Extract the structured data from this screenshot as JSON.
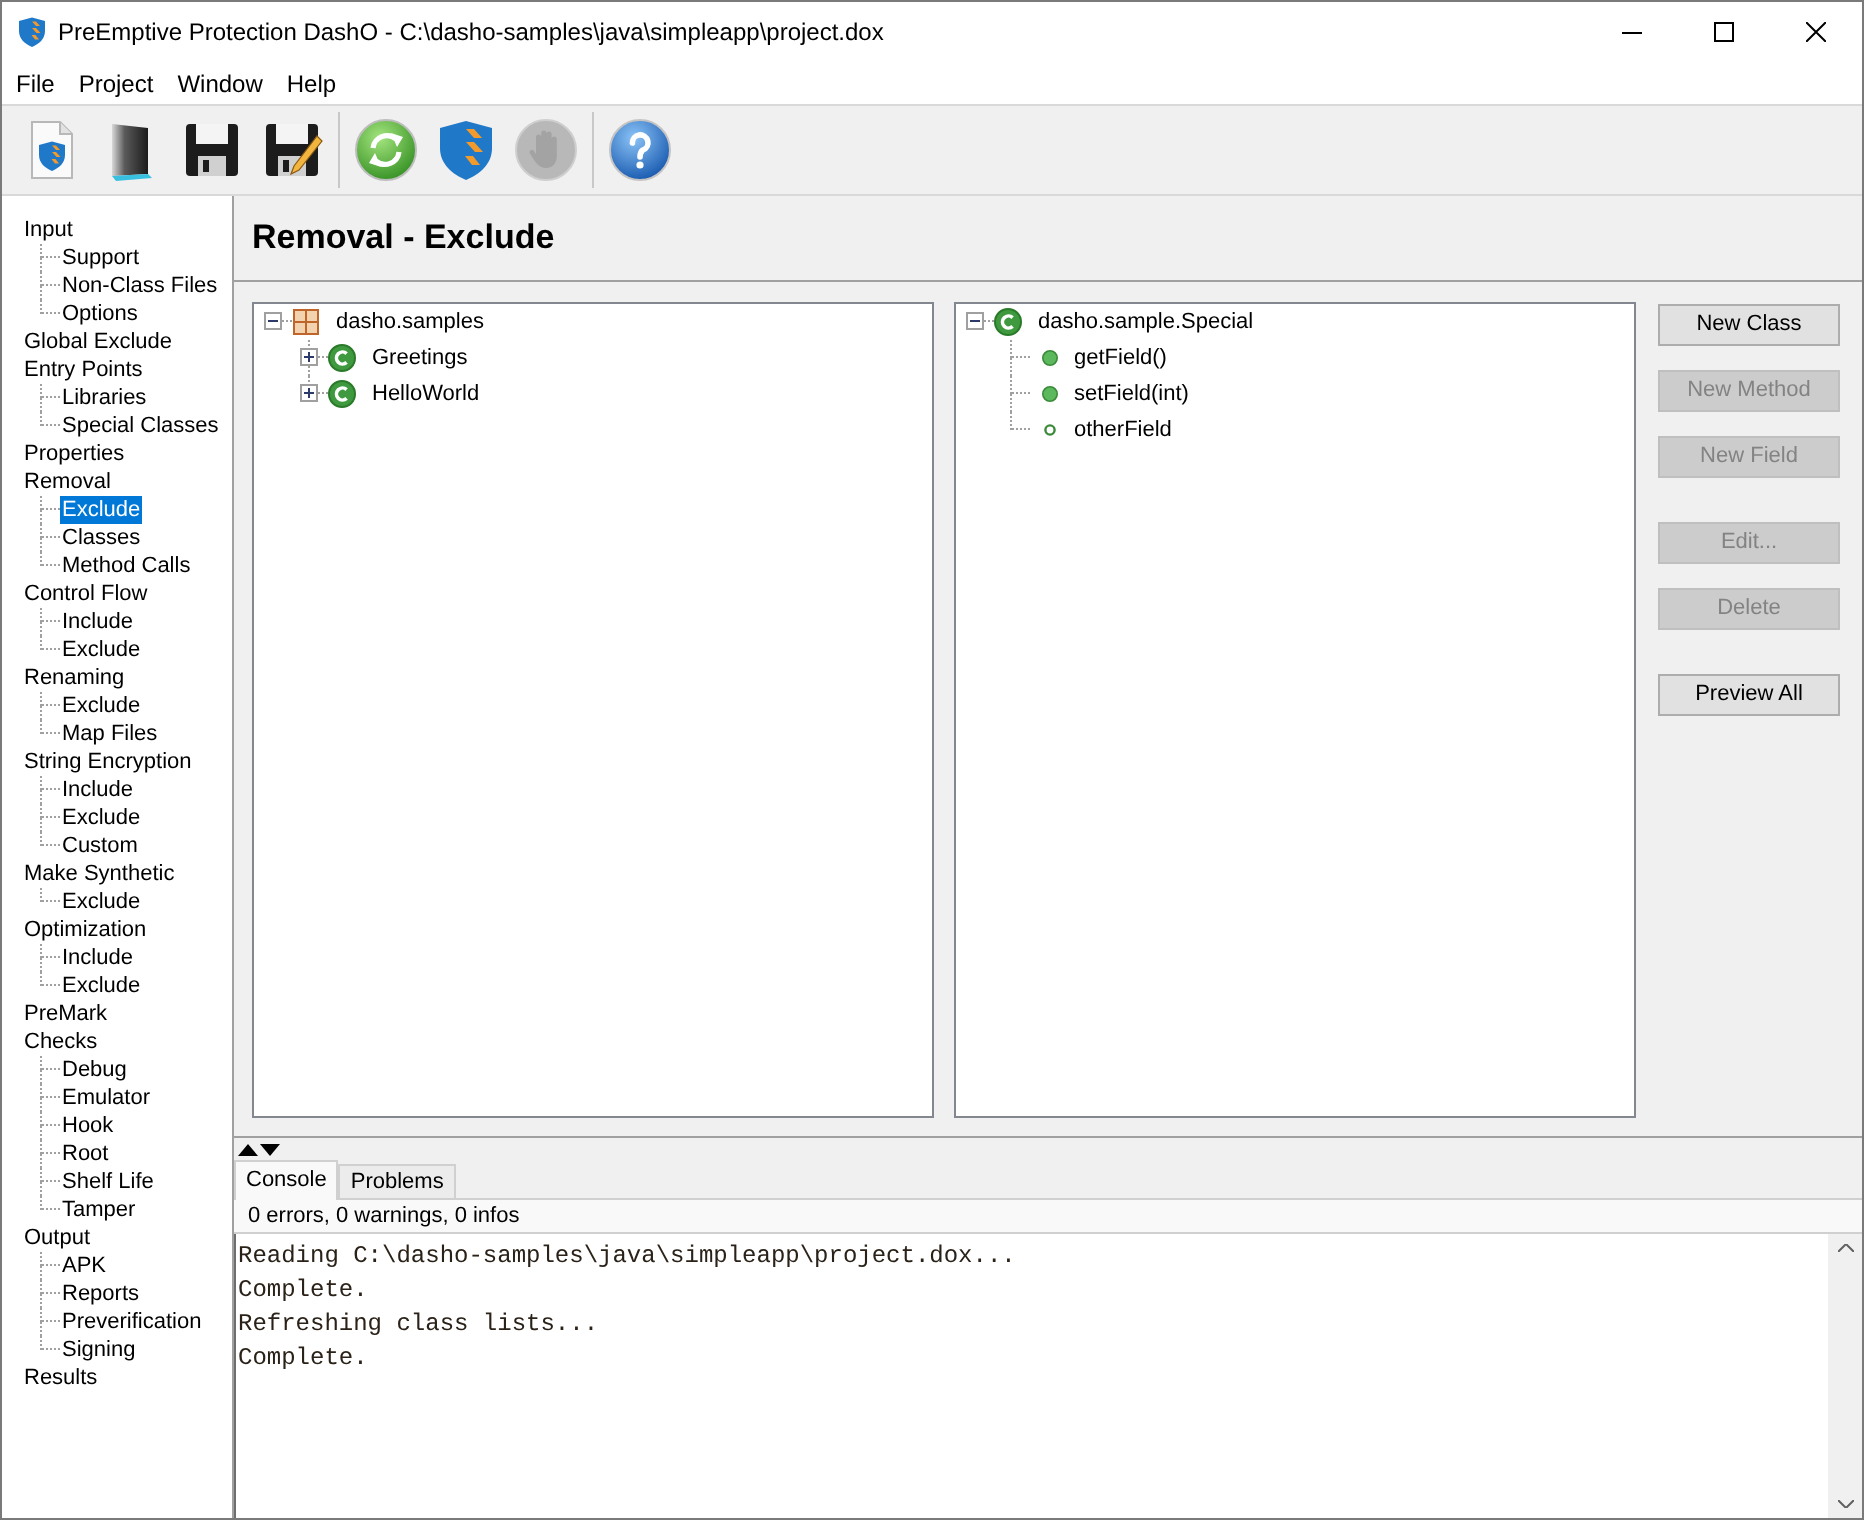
{
  "window": {
    "title": "PreEmptive Protection DashO - C:\\dasho-samples\\java\\simpleapp\\project.dox"
  },
  "menu": [
    {
      "label": "File"
    },
    {
      "label": "Project"
    },
    {
      "label": "Window"
    },
    {
      "label": "Help"
    }
  ],
  "toolbar": [
    [
      {
        "kind": "new",
        "disabled": false
      },
      {
        "kind": "open",
        "disabled": false
      },
      {
        "kind": "save",
        "disabled": false
      },
      {
        "kind": "save_as",
        "disabled": false
      }
    ],
    [
      {
        "kind": "refresh",
        "disabled": false
      },
      {
        "kind": "build",
        "disabled": false
      },
      {
        "kind": "stop",
        "disabled": true
      }
    ],
    [
      {
        "kind": "help",
        "disabled": false
      }
    ]
  ],
  "sidebar": {
    "items": [
      {
        "label": "Input",
        "selected": false,
        "children": [
          {
            "label": "Support",
            "selected": false
          },
          {
            "label": "Non-Class Files",
            "selected": false
          },
          {
            "label": "Options",
            "selected": false
          }
        ]
      },
      {
        "label": "Global Exclude",
        "selected": false
      },
      {
        "label": "Entry Points",
        "selected": false,
        "children": [
          {
            "label": "Libraries",
            "selected": false
          },
          {
            "label": "Special Classes",
            "selected": false
          }
        ]
      },
      {
        "label": "Properties",
        "selected": false
      },
      {
        "label": "Removal",
        "selected": false,
        "children": [
          {
            "label": "Exclude",
            "selected": true
          },
          {
            "label": "Classes",
            "selected": false
          },
          {
            "label": "Method Calls",
            "selected": false
          }
        ]
      },
      {
        "label": "Control Flow",
        "selected": false,
        "children": [
          {
            "label": "Include",
            "selected": false
          },
          {
            "label": "Exclude",
            "selected": false
          }
        ]
      },
      {
        "label": "Renaming",
        "selected": false,
        "children": [
          {
            "label": "Exclude",
            "selected": false
          },
          {
            "label": "Map Files",
            "selected": false
          }
        ]
      },
      {
        "label": "String Encryption",
        "selected": false,
        "children": [
          {
            "label": "Include",
            "selected": false
          },
          {
            "label": "Exclude",
            "selected": false
          },
          {
            "label": "Custom",
            "selected": false
          }
        ]
      },
      {
        "label": "Make Synthetic",
        "selected": false,
        "children": [
          {
            "label": "Exclude",
            "selected": false
          }
        ]
      },
      {
        "label": "Optimization",
        "selected": false,
        "children": [
          {
            "label": "Include",
            "selected": false
          },
          {
            "label": "Exclude",
            "selected": false
          }
        ]
      },
      {
        "label": "PreMark",
        "selected": false
      },
      {
        "label": "Checks",
        "selected": false,
        "children": [
          {
            "label": "Debug",
            "selected": false
          },
          {
            "label": "Emulator",
            "selected": false
          },
          {
            "label": "Hook",
            "selected": false
          },
          {
            "label": "Root",
            "selected": false
          },
          {
            "label": "Shelf Life",
            "selected": false
          },
          {
            "label": "Tamper",
            "selected": false
          }
        ]
      },
      {
        "label": "Output",
        "selected": false,
        "children": [
          {
            "label": "APK",
            "selected": false
          },
          {
            "label": "Reports",
            "selected": false
          },
          {
            "label": "Preverification",
            "selected": false
          },
          {
            "label": "Signing",
            "selected": false
          }
        ]
      },
      {
        "label": "Results",
        "selected": false
      }
    ]
  },
  "panel": {
    "title": "Removal - Exclude",
    "left_tree": {
      "nodes": [
        {
          "label": "dasho.samples",
          "kind": "package",
          "expanded": true,
          "children": [
            {
              "label": "Greetings",
              "kind": "class",
              "expanded": false
            },
            {
              "label": "HelloWorld",
              "kind": "class",
              "expanded": false
            }
          ]
        }
      ]
    },
    "right_tree": {
      "nodes": [
        {
          "label": "dasho.sample.Special",
          "kind": "class",
          "expanded": true,
          "children": [
            {
              "label": "getField()",
              "kind": "method"
            },
            {
              "label": "setField(int)",
              "kind": "method"
            },
            {
              "label": "otherField",
              "kind": "field"
            }
          ]
        }
      ]
    },
    "button_groups": [
      [
        {
          "label": "New Class",
          "disabled": false
        },
        {
          "label": "New Method",
          "disabled": true
        },
        {
          "label": "New Field",
          "disabled": true
        }
      ],
      [
        {
          "label": "Edit...",
          "disabled": true
        },
        {
          "label": "Delete",
          "disabled": true
        }
      ],
      [
        {
          "label": "Preview All",
          "disabled": false
        }
      ]
    ]
  },
  "bottom": {
    "tabs": [
      {
        "label": "Console",
        "selected": true
      },
      {
        "label": "Problems",
        "selected": false
      }
    ],
    "status": "0 errors, 0 warnings, 0 infos",
    "console_lines": [
      "Reading C:\\dasho-samples\\java\\simpleapp\\project.dox...",
      "Complete.",
      "Refreshing class lists...",
      "Complete."
    ]
  }
}
